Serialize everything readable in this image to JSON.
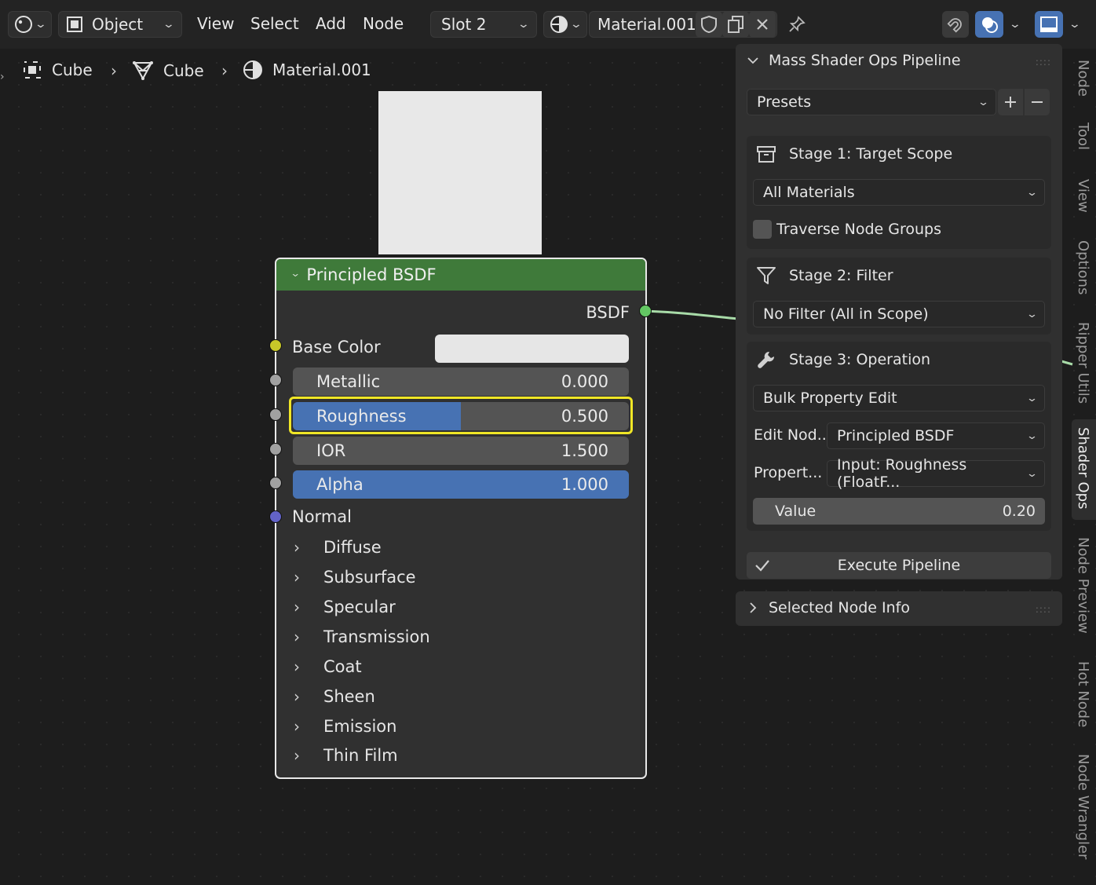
{
  "header": {
    "mode": "Object",
    "menus": [
      "View",
      "Select",
      "Add",
      "Node"
    ],
    "slot": "Slot 2",
    "material": "Material.001"
  },
  "breadcrumb": {
    "object": "Cube",
    "mesh": "Cube",
    "material": "Material.001"
  },
  "node": {
    "title": "Principled BSDF",
    "output": "BSDF",
    "base_color_label": "Base Color",
    "base_color": "#e6e6e6",
    "metallic": {
      "label": "Metallic",
      "value": "0.000",
      "fraction": 0.0
    },
    "roughness": {
      "label": "Roughness",
      "value": "0.500",
      "fraction": 0.5
    },
    "ior": {
      "label": "IOR",
      "value": "1.500",
      "fraction": 0.0
    },
    "alpha": {
      "label": "Alpha",
      "value": "1.000",
      "fraction": 1.0
    },
    "normal_label": "Normal",
    "panels": [
      "Diffuse",
      "Subsurface",
      "Specular",
      "Transmission",
      "Coat",
      "Sheen",
      "Emission",
      "Thin Film"
    ]
  },
  "npanel": {
    "title": "Mass Shader Ops Pipeline",
    "presets": "Presets",
    "stage1": {
      "title": "Stage 1: Target Scope",
      "scope": "All Materials",
      "traverse_label": "Traverse Node Groups",
      "traverse_checked": false
    },
    "stage2": {
      "title": "Stage 2: Filter",
      "filter": "No Filter (All in Scope)"
    },
    "stage3": {
      "title": "Stage 3: Operation",
      "operation": "Bulk Property Edit",
      "edit_node_label": "Edit Nod...",
      "edit_node": "Principled BSDF",
      "property_label": "Propert...",
      "property": "Input: Roughness (FloatF...",
      "value_label": "Value",
      "value": "0.20"
    },
    "execute": "Execute Pipeline",
    "selected_info": "Selected Node Info"
  },
  "side_tabs": [
    "Node",
    "Tool",
    "View",
    "Options",
    "Ripper Utils",
    "Shader Ops",
    "Node Preview",
    "Hot Node",
    "Node Wrangler"
  ],
  "colors": {
    "accent_blue": "#4772b3",
    "node_header": "#3f7a3a",
    "highlight": "#f0e626",
    "socket_yellow": "#c7c729",
    "socket_grey": "#a1a1a1",
    "socket_purple": "#6363c7",
    "socket_green": "#63c763"
  }
}
